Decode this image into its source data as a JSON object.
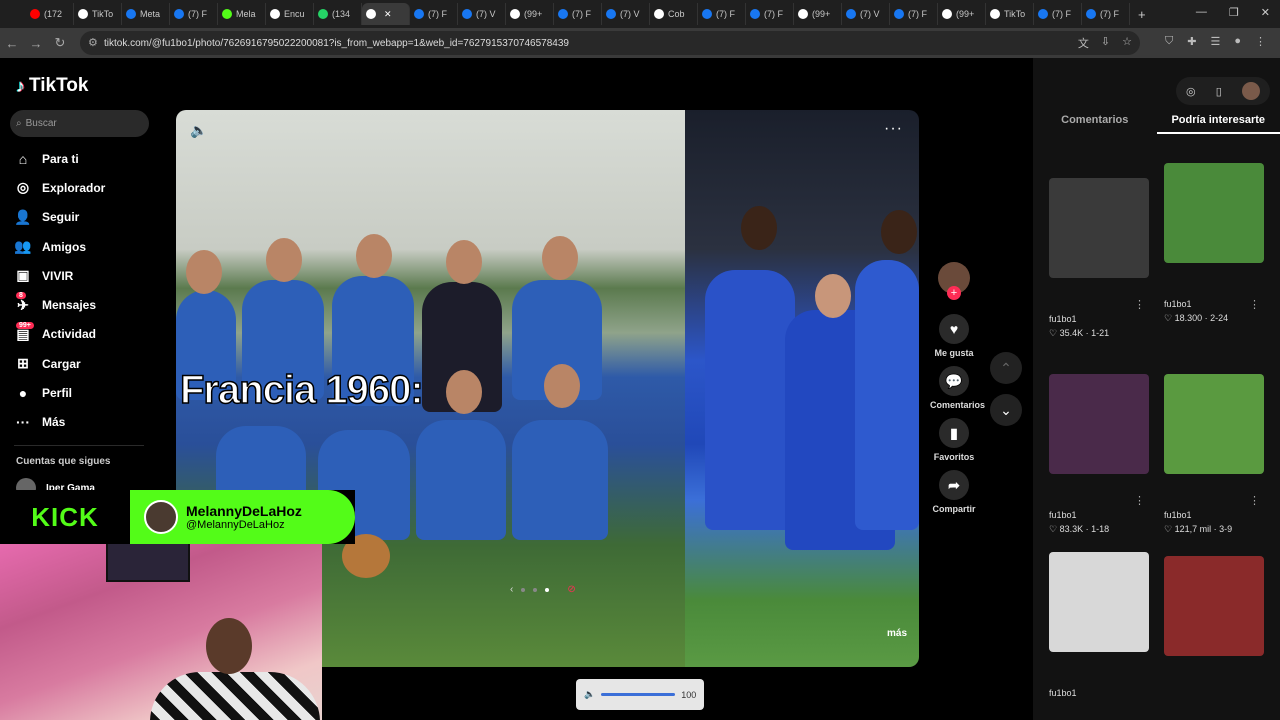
{
  "browser": {
    "tabs": [
      {
        "label": "(172",
        "color": "#ff0000"
      },
      {
        "label": "TikTo",
        "color": "#ffffff"
      },
      {
        "label": "Meta",
        "color": "#1877f2"
      },
      {
        "label": "(7) F",
        "color": "#1877f2"
      },
      {
        "label": "Mela",
        "color": "#53fc18"
      },
      {
        "label": "Encu",
        "color": "#ffffff"
      },
      {
        "label": "(134",
        "color": "#25d366"
      },
      {
        "label": "",
        "color": "#ffffff",
        "active": true
      },
      {
        "label": "(7) F",
        "color": "#1877f2"
      },
      {
        "label": "(7) V",
        "color": "#1877f2"
      },
      {
        "label": "(99+",
        "color": "#ffffff"
      },
      {
        "label": "(7) F",
        "color": "#1877f2"
      },
      {
        "label": "(7) V",
        "color": "#1877f2"
      },
      {
        "label": "Cob",
        "color": "#ffffff"
      },
      {
        "label": "(7) F",
        "color": "#1877f2"
      },
      {
        "label": "(7) F",
        "color": "#1877f2"
      },
      {
        "label": "(99+",
        "color": "#ffffff"
      },
      {
        "label": "(7) V",
        "color": "#1877f2"
      },
      {
        "label": "(7) F",
        "color": "#1877f2"
      },
      {
        "label": "(99+",
        "color": "#ffffff"
      },
      {
        "label": "TikTo",
        "color": "#ffffff"
      },
      {
        "label": "(7) F",
        "color": "#1877f2"
      },
      {
        "label": "(7) F",
        "color": "#1877f2"
      }
    ],
    "url": "tiktok.com/@fu1bo1/photo/7626916795022200081?is_from_webapp=1&web_id=7627915370746578439"
  },
  "sidebar": {
    "brand": "TikTok",
    "search_placeholder": "Buscar",
    "items": [
      {
        "label": "Para ti",
        "icon": "home-icon",
        "glyph": "⌂"
      },
      {
        "label": "Explorador",
        "icon": "compass-icon",
        "glyph": "◎"
      },
      {
        "label": "Seguir",
        "icon": "following-icon",
        "glyph": "👤"
      },
      {
        "label": "Amigos",
        "icon": "friends-icon",
        "glyph": "👥"
      },
      {
        "label": "VIVIR",
        "icon": "live-icon",
        "glyph": "▣"
      },
      {
        "label": "Mensajes",
        "icon": "messages-icon",
        "glyph": "✈",
        "badge": "8"
      },
      {
        "label": "Actividad",
        "icon": "activity-icon",
        "glyph": "▤",
        "badge": "99+"
      },
      {
        "label": "Cargar",
        "icon": "upload-icon",
        "glyph": "⊞"
      },
      {
        "label": "Perfil",
        "icon": "profile-icon",
        "glyph": "●"
      },
      {
        "label": "Más",
        "icon": "more-icon",
        "glyph": "···"
      }
    ],
    "following_title": "Cuentas que sigues",
    "following": [
      {
        "name": "Iper Gama"
      }
    ]
  },
  "post": {
    "overlay_text": "Francia 1960:",
    "more_label": "más",
    "actions": {
      "like": "Me gusta",
      "comments": "Comentarios",
      "favorites": "Favoritos",
      "share": "Compartir"
    }
  },
  "volume": {
    "value": "100"
  },
  "panel": {
    "tabs": [
      "Comentarios",
      "Podría interesarte"
    ],
    "cards": [
      {
        "author": "fu1bo1",
        "stats": "♡ 35.4K · 1-21",
        "color": "#3a3a3a"
      },
      {
        "author": "fu1bo1",
        "stats": "♡ 18.300 · 2-24",
        "color": "#4a8a3a"
      },
      {
        "author": "fu1bo1",
        "stats": "♡ 83.3K · 1-18",
        "color": "#4a2a4a"
      },
      {
        "author": "fu1bo1",
        "stats": "♡ 121,7 mil · 3-9",
        "color": "#5a9a40"
      },
      {
        "author": "fu1bo1",
        "stats": "",
        "color": "#d8d8d8"
      },
      {
        "author": "",
        "stats": "",
        "color": "#8a2a2a"
      }
    ]
  },
  "stream": {
    "platform": "KICK",
    "display_name": "MelannyDeLaHoz",
    "handle": "@MelannyDeLaHoz"
  },
  "colors": {
    "accent": "#fe2c55",
    "kick_green": "#53fc18"
  }
}
